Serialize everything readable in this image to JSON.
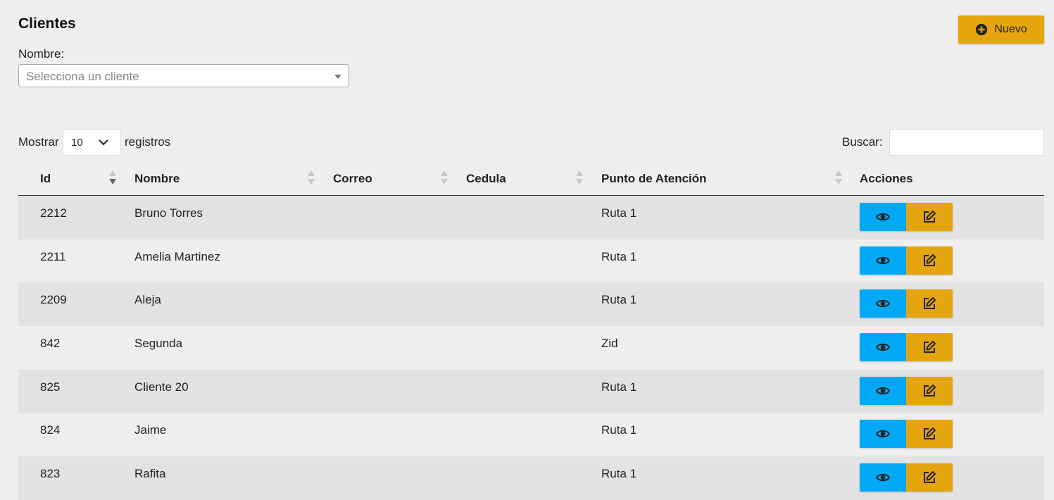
{
  "header": {
    "title": "Clientes",
    "new_button_label": "Nuevo"
  },
  "filter": {
    "label": "Nombre:",
    "placeholder": "Selecciona un cliente"
  },
  "table_controls": {
    "show_label": "Mostrar",
    "page_length": "10",
    "records_label": "registros",
    "search_label": "Buscar:",
    "search_value": ""
  },
  "table": {
    "columns": [
      "Id",
      "Nombre",
      "Correo",
      "Cedula",
      "Punto de Atención",
      "Acciones"
    ],
    "sorted_column": "Id",
    "sort_direction": "desc",
    "rows": [
      {
        "id": "2212",
        "nombre": "Bruno Torres",
        "correo": "",
        "cedula": "",
        "punto": "Ruta 1"
      },
      {
        "id": "2211",
        "nombre": "Amelia Martinez",
        "correo": "",
        "cedula": "",
        "punto": "Ruta 1"
      },
      {
        "id": "2209",
        "nombre": "Aleja",
        "correo": "",
        "cedula": "",
        "punto": "Ruta 1"
      },
      {
        "id": "842",
        "nombre": "Segunda",
        "correo": "",
        "cedula": "",
        "punto": "Zid"
      },
      {
        "id": "825",
        "nombre": "Cliente 20",
        "correo": "",
        "cedula": "",
        "punto": "Ruta 1"
      },
      {
        "id": "824",
        "nombre": "Jaime",
        "correo": "",
        "cedula": "",
        "punto": "Ruta 1"
      },
      {
        "id": "823",
        "nombre": "Rafita",
        "correo": "",
        "cedula": "",
        "punto": "Ruta 1"
      }
    ],
    "row_action_icons": [
      "eye-icon",
      "edit-icon"
    ]
  },
  "colors": {
    "accent": "#e5a50e",
    "view_button": "#03a9f4",
    "row_stripe": "#e2e2e2",
    "background": "#eeeeee"
  }
}
